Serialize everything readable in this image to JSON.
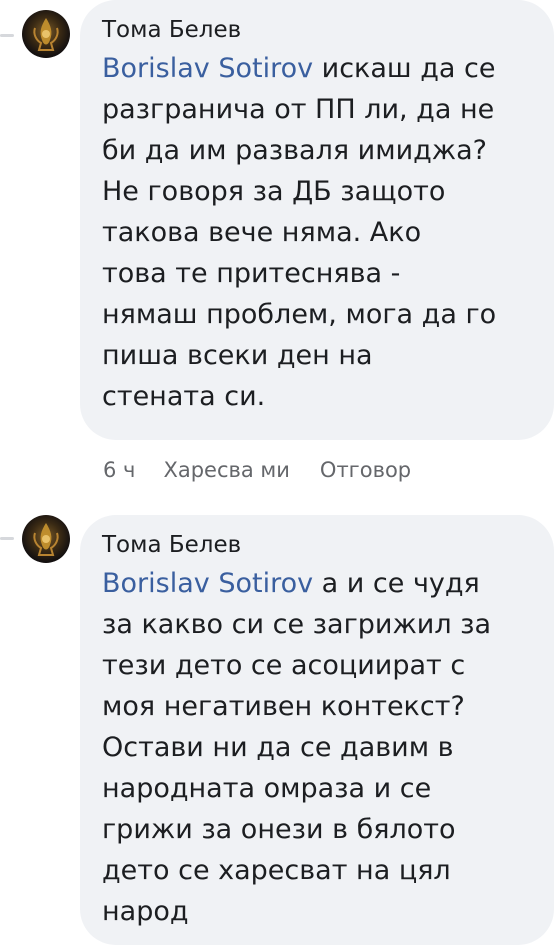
{
  "comments": [
    {
      "author": "Тома Белев",
      "mention": "Borislav Sotirov",
      "lines": [
        " искаш да се",
        "разгранича от ПП ли, да не",
        "би да им разваля имиджа?",
        "Не говоря за ДБ защото",
        "такова вече няма. Ако",
        "това те притеснява -",
        "нямаш проблем, мога да го",
        "пиша всеки ден на",
        "стената си."
      ],
      "time": "6 ч",
      "like_label": "Харесва ми",
      "reply_label": "Отговор"
    },
    {
      "author": "Тома Белев",
      "mention": "Borislav Sotirov",
      "lines": [
        " а и се чудя",
        "за какво си се загрижил за",
        "тези дето се асоциират с",
        "моя негативен контекст?",
        "Остави ни да се давим в",
        "народната омраза и се",
        "грижи за онези в бялото",
        "дето се харесват на цял",
        "народ"
      ]
    }
  ],
  "colors": {
    "bubble": "#f0f2f5",
    "text": "#1c1e21",
    "mention": "#3a5f9f",
    "meta": "#65676b"
  }
}
